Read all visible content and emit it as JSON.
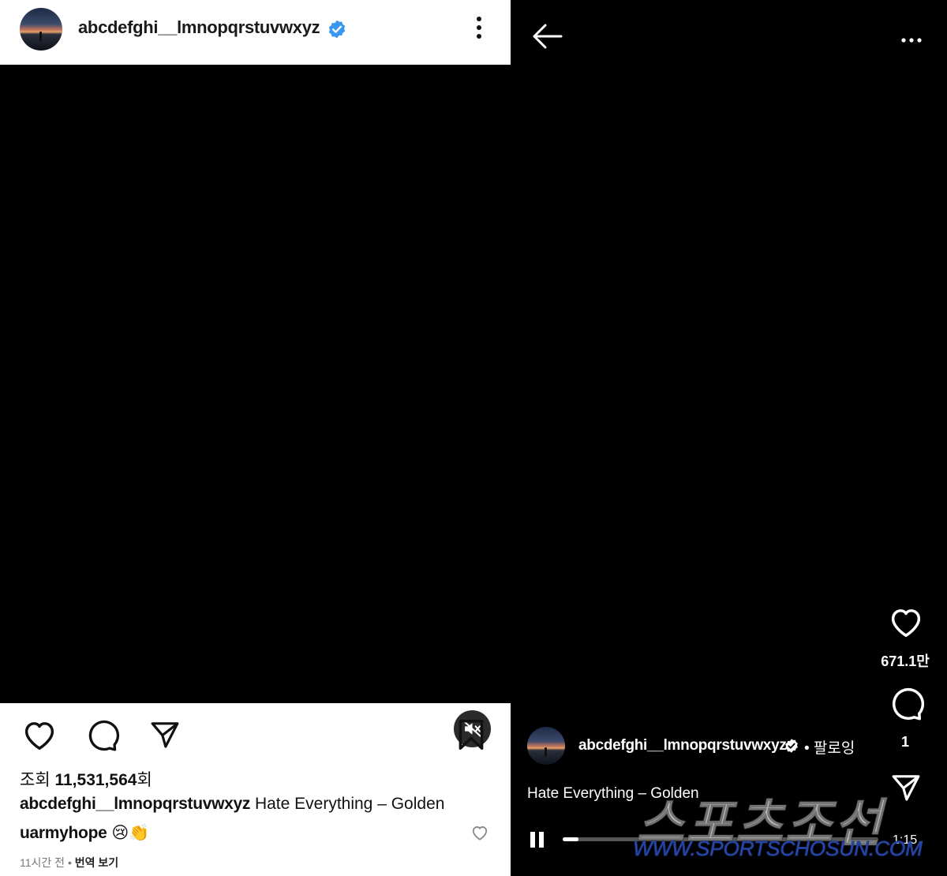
{
  "left": {
    "username": "abcdefghi__lmnopqrstuvwxyz",
    "views_prefix": "조회",
    "views_count": "11,531,564",
    "views_suffix": "회",
    "caption_user": "abcdefghi__lmnopqrstuvwxyz",
    "caption_text": "Hate Everything – Golden",
    "comment_user": "uarmyhope",
    "comment_emoji": "😢👏",
    "time_ago": "11시간 전",
    "separator": "•",
    "translate": "번역 보기"
  },
  "right": {
    "like_count": "671.1만",
    "comment_count": "1",
    "username": "abcdefghi__lmnopqrstuvwxyz",
    "follow_status": "• 팔로잉",
    "song": "Hate Everything – Golden",
    "time": "1:15",
    "progress": 0.05
  },
  "watermark": {
    "main": "스포츠조선",
    "url": "WWW.SPORTSCHOSUN.COM"
  },
  "icons": {
    "verified": "verified-badge-icon",
    "more": "more-options-icon",
    "mute": "muted-speaker-icon",
    "heart": "heart-icon",
    "comment": "comment-bubble-icon",
    "share": "paper-plane-icon",
    "save": "bookmark-icon",
    "back": "back-arrow-icon",
    "pause": "pause-icon"
  },
  "colors": {
    "verified_blue": "#3897f0",
    "watermark_blue": "#2a4aa8"
  }
}
